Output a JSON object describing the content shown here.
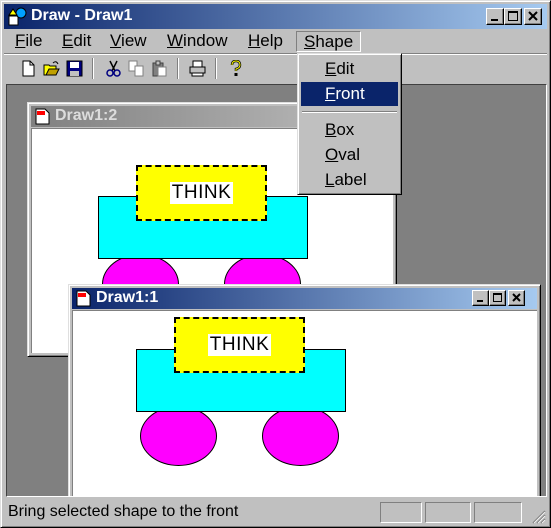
{
  "window": {
    "title": "Draw - Draw1"
  },
  "menubar": {
    "items": [
      {
        "mn": "F",
        "rest": "ile"
      },
      {
        "mn": "E",
        "rest": "dit"
      },
      {
        "mn": "V",
        "rest": "iew"
      },
      {
        "mn": "W",
        "rest": "indow"
      },
      {
        "mn": "H",
        "rest": "elp"
      },
      {
        "mn": "S",
        "rest": "hape"
      }
    ],
    "open_menu": "Shape"
  },
  "toolbar": {
    "buttons": [
      "new-icon",
      "open-icon",
      "save-icon",
      "cut-icon",
      "copy-icon",
      "paste-icon",
      "print-icon",
      "help-icon"
    ]
  },
  "shape_menu": {
    "items": [
      {
        "mn": "E",
        "rest": "dit",
        "highlighted": false
      },
      {
        "mn": "F",
        "rest": "ront",
        "highlighted": true
      },
      {
        "mn": "B",
        "rest": "ox",
        "highlighted": false
      },
      {
        "mn": "O",
        "rest": "val",
        "highlighted": false
      },
      {
        "mn": "L",
        "rest": "abel",
        "highlighted": false
      }
    ]
  },
  "documents": {
    "back": {
      "title": "Draw1:2",
      "label_text": "THINK",
      "active": false
    },
    "front": {
      "title": "Draw1:1",
      "label_text": "THINK",
      "active": true
    }
  },
  "colors": {
    "box": "#00ffff",
    "oval": "#ff00ff",
    "label": "#ffff00",
    "active_title": "#0a246a",
    "inactive_title": "#808080"
  },
  "statusbar": {
    "text": "Bring selected shape to the front"
  }
}
